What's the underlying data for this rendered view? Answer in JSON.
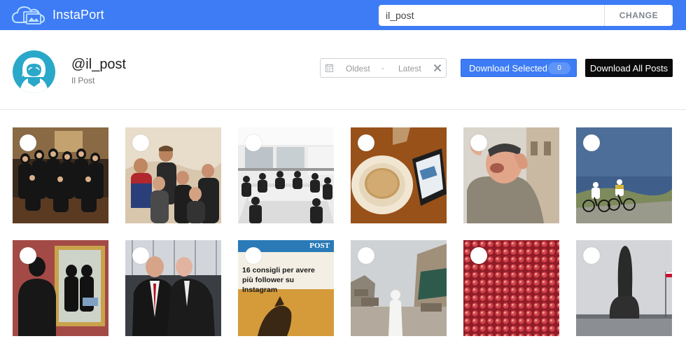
{
  "header": {
    "brand": "InstaPort",
    "search_value": "il_post",
    "change_label": "CHANGE",
    "accent": "#3d7cf5"
  },
  "profile": {
    "username": "@il_post",
    "full_name": "Il Post",
    "avatar_icon": "user-silhouette-icon",
    "date_from_placeholder": "Oldest",
    "date_separator": "-",
    "date_to_placeholder": "Latest",
    "download_selected_label": "Download Selected",
    "selected_count": "0",
    "download_all_label": "Download All Posts"
  },
  "posts": [
    {
      "scene": "group photo at night",
      "selected": false
    },
    {
      "scene": "selfie in snow",
      "selected": false
    },
    {
      "scene": "newsroom meeting",
      "selected": false
    },
    {
      "scene": "soup bowl and tablet",
      "selected": false
    },
    {
      "scene": "laughing man",
      "selected": false
    },
    {
      "scene": "cyclists on hill",
      "selected": false
    },
    {
      "scene": "man viewing painting",
      "selected": false
    },
    {
      "scene": "men in parliament",
      "selected": false
    },
    {
      "scene": "article cover",
      "caption": "16 consigli per avere più follower su Instagram",
      "masthead": "POST",
      "selected": false
    },
    {
      "scene": "pope in ruins",
      "selected": false
    },
    {
      "scene": "red crowd from above",
      "selected": false
    },
    {
      "scene": "thumb sculpture",
      "selected": false
    }
  ]
}
